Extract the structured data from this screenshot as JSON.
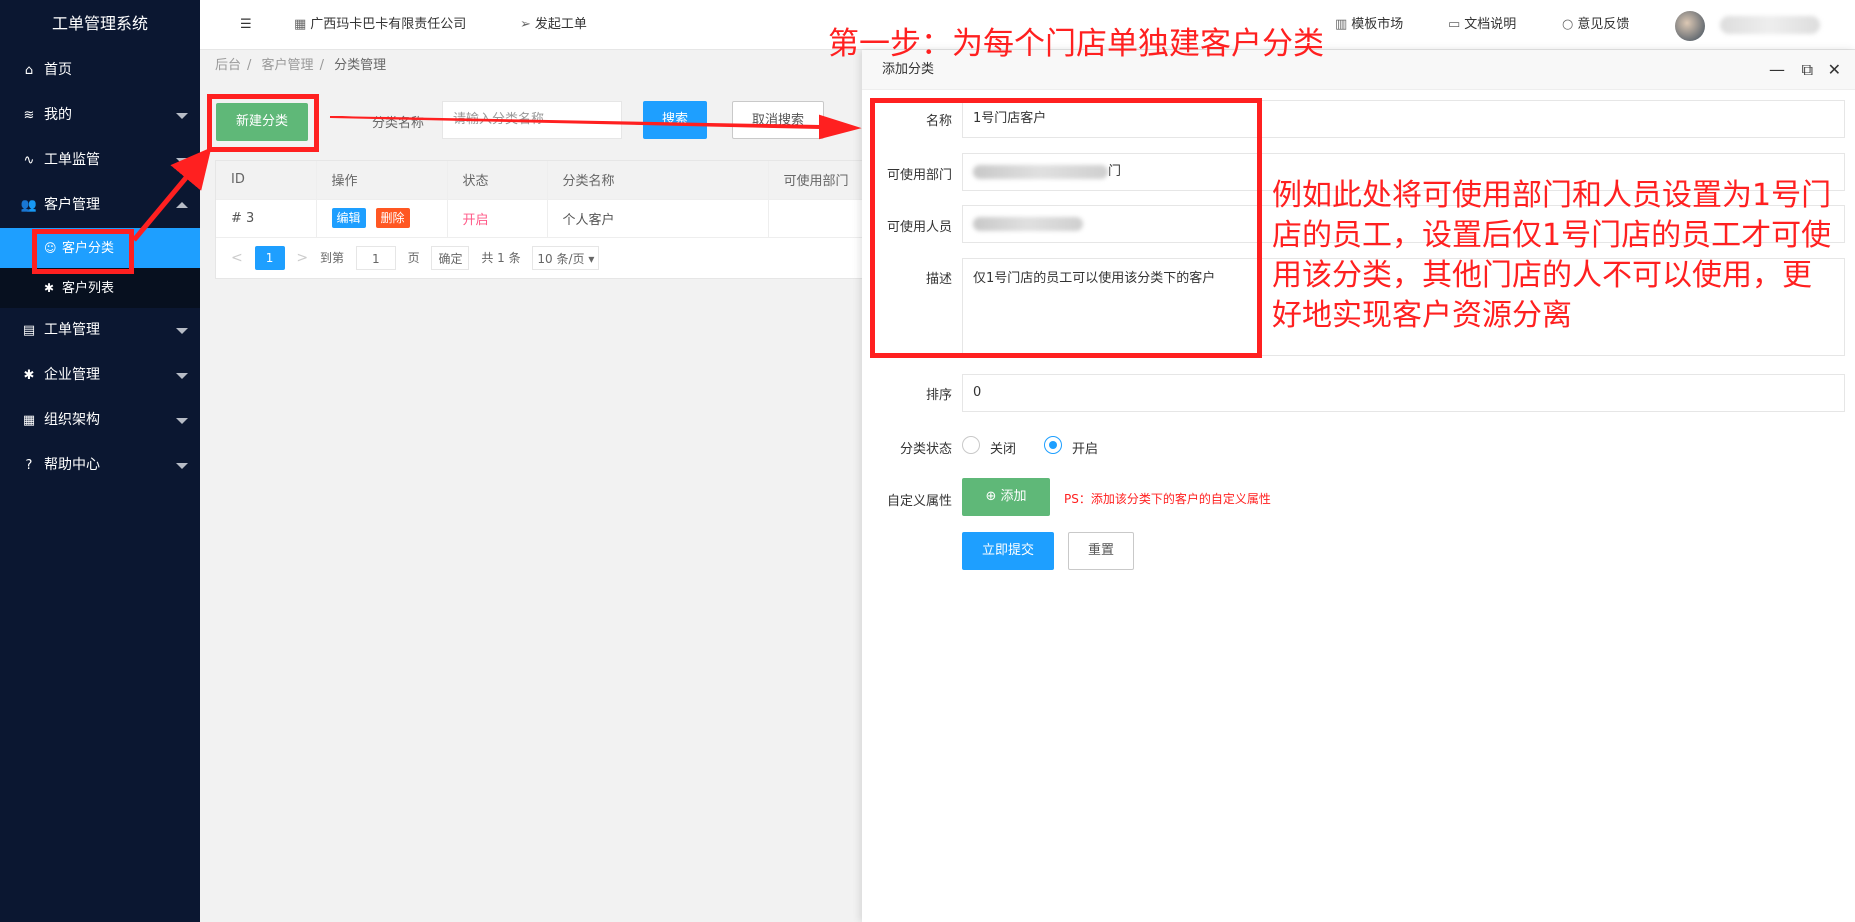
{
  "app": {
    "title": "工单管理系统"
  },
  "sidebar": {
    "items": [
      {
        "label": "首页",
        "icon": "home-icon"
      },
      {
        "label": "我的",
        "icon": "layers-icon"
      },
      {
        "label": "工单监管",
        "icon": "pulse-icon"
      },
      {
        "label": "客户管理",
        "icon": "users-icon"
      },
      {
        "label": "工单管理",
        "icon": "clipboard-icon"
      },
      {
        "label": "企业管理",
        "icon": "gear-icon"
      },
      {
        "label": "组织架构",
        "icon": "calendar-icon"
      },
      {
        "label": "帮助中心",
        "icon": "help-icon"
      }
    ],
    "sub": [
      {
        "label": "客户分类",
        "icon": "user-icon"
      },
      {
        "label": "客户列表",
        "icon": "gear-icon"
      }
    ]
  },
  "topbar": {
    "company": "广西玛卡巴卡有限责任公司",
    "create_ticket": "发起工单",
    "template_market": "模板市场",
    "docs": "文档说明",
    "feedback": "意见反馈"
  },
  "breadcrumb": [
    "后台",
    "客户管理",
    "分类管理"
  ],
  "toolbar": {
    "new_label": "新建分类",
    "search_label": "分类名称",
    "search_placeholder": "请输入分类名称",
    "search_button": "搜索",
    "cancel_button": "取消搜索"
  },
  "table": {
    "columns": [
      "ID",
      "操作",
      "状态",
      "分类名称",
      "可使用部门"
    ],
    "rows": [
      {
        "id": "# 3",
        "edit": "编辑",
        "delete": "删除",
        "status": "开启",
        "name": "个人客户",
        "dept": ""
      }
    ]
  },
  "pager": {
    "current": "1",
    "goto_label": "到第",
    "page_input": "1",
    "page_unit": "页",
    "confirm": "确定",
    "total": "共 1 条",
    "page_size": "10 条/页"
  },
  "dialog": {
    "title": "添加分类",
    "fields": {
      "name_label": "名称",
      "name_value": "1号门店客户",
      "dept_label": "可使用部门",
      "dept_value_tail": "门",
      "staff_label": "可使用人员",
      "desc_label": "描述",
      "desc_value": "仅1号门店的员工可以使用该分类下的客户",
      "sort_label": "排序",
      "sort_value": "0",
      "status_label": "分类状态",
      "status_off": "关闭",
      "status_on": "开启",
      "status_selected": "开启",
      "custom_label": "自定义属性",
      "add_button": "添加",
      "ps_note": "PS：添加该分类下的客户的自定义属性"
    },
    "submit": "立即提交",
    "reset": "重置"
  },
  "annotations": {
    "title": "第一步：为每个门店单独建客户分类",
    "body": "例如此处将可使用部门和人员设置为1号门店的员工，设置后仅1号门店的员工才可使用该分类，其他门店的人不可以使用，更好地实现客户资源分离"
  },
  "colors": {
    "sidebar_bg": "#0b1731",
    "active": "#1e9fff",
    "green": "#5fb878",
    "annotation": "#ff2020",
    "delete": "#ff5722"
  }
}
